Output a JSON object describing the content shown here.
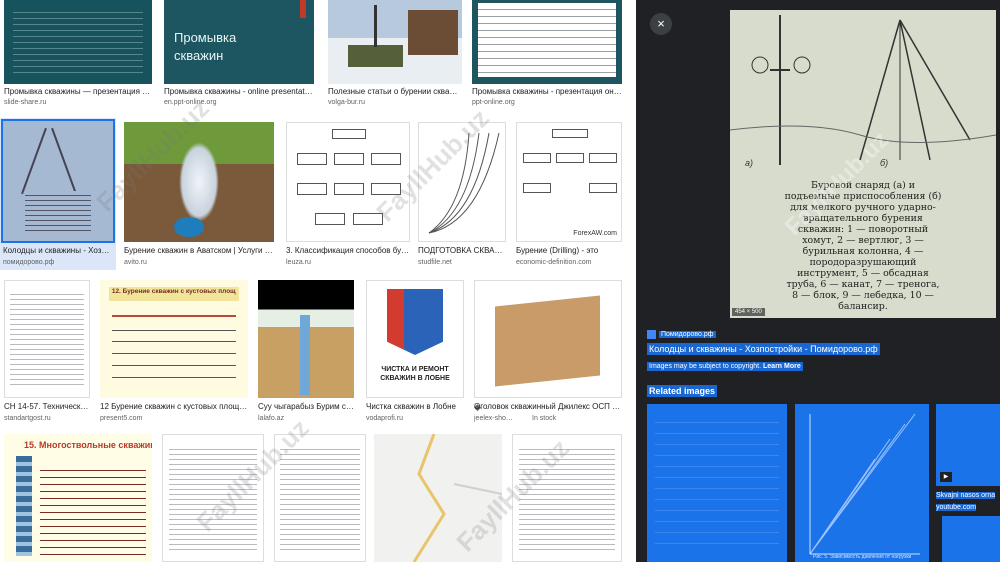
{
  "results": [
    {
      "title": "Промывка скважины — презентация на Sli...",
      "source": "slide-share.ru"
    },
    {
      "title": "Промывка скважины - online presentation",
      "source": "en.ppt-online.org",
      "slide_line1": "Промывка",
      "slide_line2": "скважин"
    },
    {
      "title": "Полезные статьи о бурении скважин...",
      "source": "volga-bur.ru"
    },
    {
      "title": "Промывка скважины - презентация онлай...",
      "source": "ppt-online.org"
    },
    {
      "title": "Колодцы и скважины - Хозпо...",
      "source": "помидорово.рф"
    },
    {
      "title": "Бурение скважин в Аватском | Услуги | А...",
      "source": "avito.ru"
    },
    {
      "title": "3. Классификация способов бур...",
      "source": "leuza.ru"
    },
    {
      "title": "ПОДГОТОВКА СКВАЖ...",
      "source": "studfile.net"
    },
    {
      "title": "Бурение (Drilling) - это",
      "source": "economic-definition.com",
      "overlay": "ForexAW.com"
    },
    {
      "title": "СН 14-57. Технические...",
      "source": "standartgost.ru"
    },
    {
      "title": "12 Бурение скважин с кустовых площад...",
      "source": "present5.com",
      "card_heading": "12. Бурение скважин с кустовых площадок"
    },
    {
      "title": "Суу чыгарабыз Бурим ск...",
      "source": "lalafo.az"
    },
    {
      "title": "Чистка скважин в Лобне",
      "source": "vodaprofi.ru",
      "poster_text": "ЧИСТКА И РЕМОНТ СКВАЖИН В ЛОБНЕ"
    },
    {
      "title": "Оголовок скважинный Джилекс ОСП 14...",
      "source": "jeelex-shop.ru",
      "in_stock": "In stock"
    },
    {
      "title": "",
      "source": "",
      "card_heading": "15. Многоствольные скважины"
    },
    {
      "title": "",
      "source": ""
    },
    {
      "title": "",
      "source": ""
    },
    {
      "title": "",
      "source": ""
    },
    {
      "title": "",
      "source": ""
    }
  ],
  "viewer": {
    "close_icon": "×",
    "dimensions": "454 × 500",
    "caption_lines": [
      "Буровой снаряд (а) и",
      "подъемные приспособления (б)",
      "для мелкого ручного ударно-",
      "вращательного бурения",
      "скважин: 1 — поворотный",
      "хомут, 2 — вертлюг, 3 —",
      "бурильная колонна, 4 —",
      "породоразрушающий",
      "инструмент, 5 — обсадная",
      "труба, 6 — канат, 7 — тренога,",
      "8 — блок, 9 — лебедка, 10 —",
      "балансир."
    ],
    "fig_label_a": "а)",
    "fig_label_b": "б)",
    "site_name": "Помидорово.рф",
    "page_title": "Колодцы и скважины - Хозпостройки - Помидорово.рф",
    "copyright_text": "Images may be subject to copyright.",
    "learn_more": "Learn More",
    "related_title": "Related images",
    "related": [
      {
        "label": ""
      },
      {
        "label": ""
      },
      {
        "label": "Skvajni nasos orna",
        "source": "youtube.com"
      }
    ],
    "related_fig_caption": "Рис. 5. Зависимость давления от нагрузки"
  },
  "watermark_text": "FayllHub.uz",
  "colors": {
    "accent": "#1a73e8",
    "viewer_bg": "#202124",
    "highlight": "#1967d2"
  }
}
